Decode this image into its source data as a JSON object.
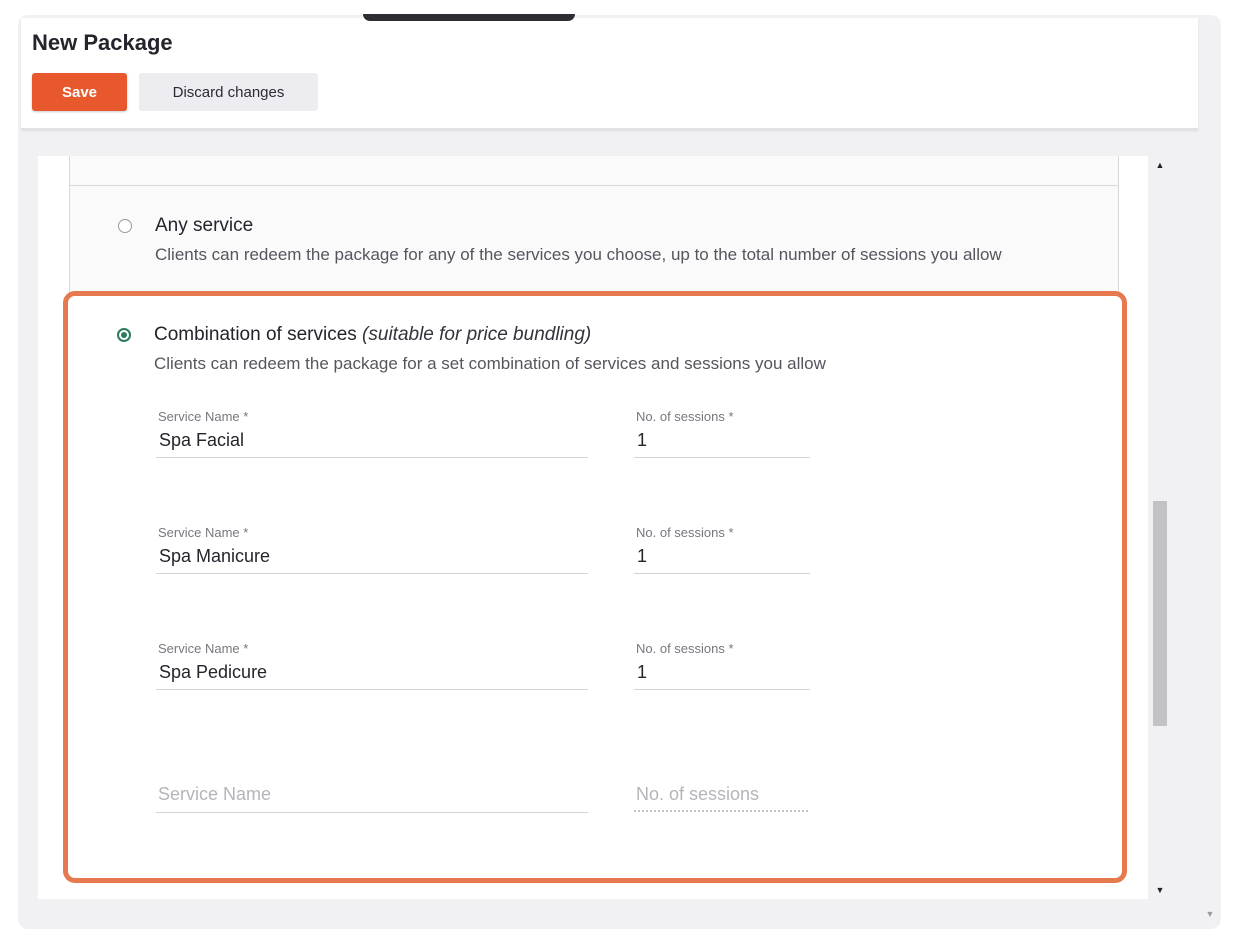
{
  "page": {
    "title": "New Package",
    "save_label": "Save",
    "discard_label": "Discard changes"
  },
  "options": {
    "any": {
      "title": "Any service",
      "description": "Clients can redeem the package for any of the services you choose, up to the total number of sessions you allow",
      "selected": false
    },
    "combo": {
      "title": "Combination of services",
      "note": "(suitable for price bundling)",
      "description": "Clients can redeem the package for a set combination of services and sessions you allow",
      "selected": true
    }
  },
  "service_rows": [
    {
      "name_label": "Service Name *",
      "name": "Spa Facial",
      "sessions_label": "No. of sessions *",
      "sessions": "1"
    },
    {
      "name_label": "Service Name *",
      "name": "Spa Manicure",
      "sessions_label": "No. of sessions *",
      "sessions": "1"
    },
    {
      "name_label": "Service Name *",
      "name": "Spa Pedicure",
      "sessions_label": "No. of sessions *",
      "sessions": "1"
    }
  ],
  "empty_row": {
    "name_placeholder": "Service Name",
    "sessions_placeholder": "No. of sessions"
  },
  "scrollbar": {
    "up_icon": "▲",
    "down_icon": "▼"
  },
  "colors": {
    "save": "#e8582d",
    "highlight": "#e7794f",
    "radio_selected": "#2c7a5c"
  }
}
